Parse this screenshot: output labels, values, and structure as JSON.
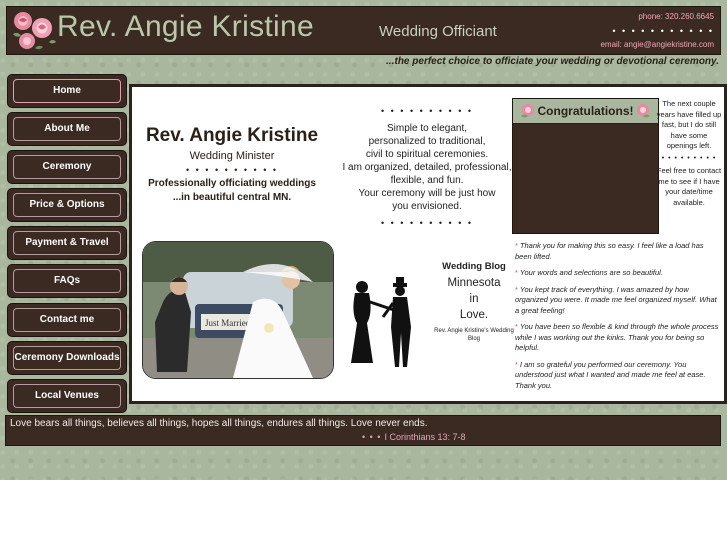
{
  "header": {
    "site_name": "Rev. Angie Kristine",
    "role": "Wedding Officiant",
    "phone": "phone: 320.260.6645",
    "email": "email: angie@angiekristine.com",
    "dots": "• • • • • • • • • • •",
    "tagline": "...the perfect choice to officiate your wedding or devotional ceremony."
  },
  "nav": {
    "items": [
      {
        "label": "Home"
      },
      {
        "label": "About Me"
      },
      {
        "label": "Ceremony"
      },
      {
        "label": "Price & Options"
      },
      {
        "label": "Payment & Travel"
      },
      {
        "label": "FAQs"
      },
      {
        "label": "Contact me"
      },
      {
        "label": "Ceremony Downloads"
      },
      {
        "label": "Local Venues"
      }
    ]
  },
  "intro": {
    "name": "Rev. Angie Kristine",
    "title": "Wedding Minister",
    "dots": "• • • • • • • • • •",
    "line1": "Professionally officiating weddings",
    "line2": "...in beautiful central MN."
  },
  "middle": {
    "dots_top": "• • • • • • • • • •",
    "lines": [
      "Simple to elegant,",
      "personalized to traditional,",
      "civil to spiritual ceremonies.",
      "I am organized, detailed, professional,",
      "flexible, and fun.",
      "Your ceremony will be just how",
      "you envisioned."
    ],
    "dots_bottom": "• • • • • • • • • •"
  },
  "congrats": {
    "title": "Congratulations!"
  },
  "openings": {
    "text1": "The next couple years have filled up fast, but I do still have some openings left.",
    "dots": "• • • • • • • • •",
    "text2": "Feel free to contact me to see if I have your date/time available."
  },
  "blog": {
    "title": "Wedding Blog",
    "line1": "Minnesota",
    "line2": "in",
    "line3": "Love.",
    "caption": "Rev. Angie Kristine's Wedding Blog"
  },
  "testimonials": [
    "Thank you for making this so easy. I feel like a load has been lifted.",
    "Your words and selections are so beautiful.",
    "You kept track of everything. I was amazed by how organized you were. It made me feel organized myself. What a great feeling!",
    "You have been so flexible & kind through the whole process while I was working out the kinks. Thank you for being so helpful.",
    "I am so grateful you performed our ceremony. You understood just what I wanted and made me feel at ease. Thank you."
  ],
  "testimonial_star": "*",
  "photo": {
    "sign_text": "Just Married"
  },
  "footer": {
    "verse": "Love bears all things, believes all things, hopes all things, endures all things. Love never ends.",
    "ref_dots": "• • •",
    "reference": "I Corinthians 13: 7-8"
  },
  "colors": {
    "brown": "#3a2a22",
    "sage": "#a9b79e",
    "pink": "#e890a6"
  }
}
